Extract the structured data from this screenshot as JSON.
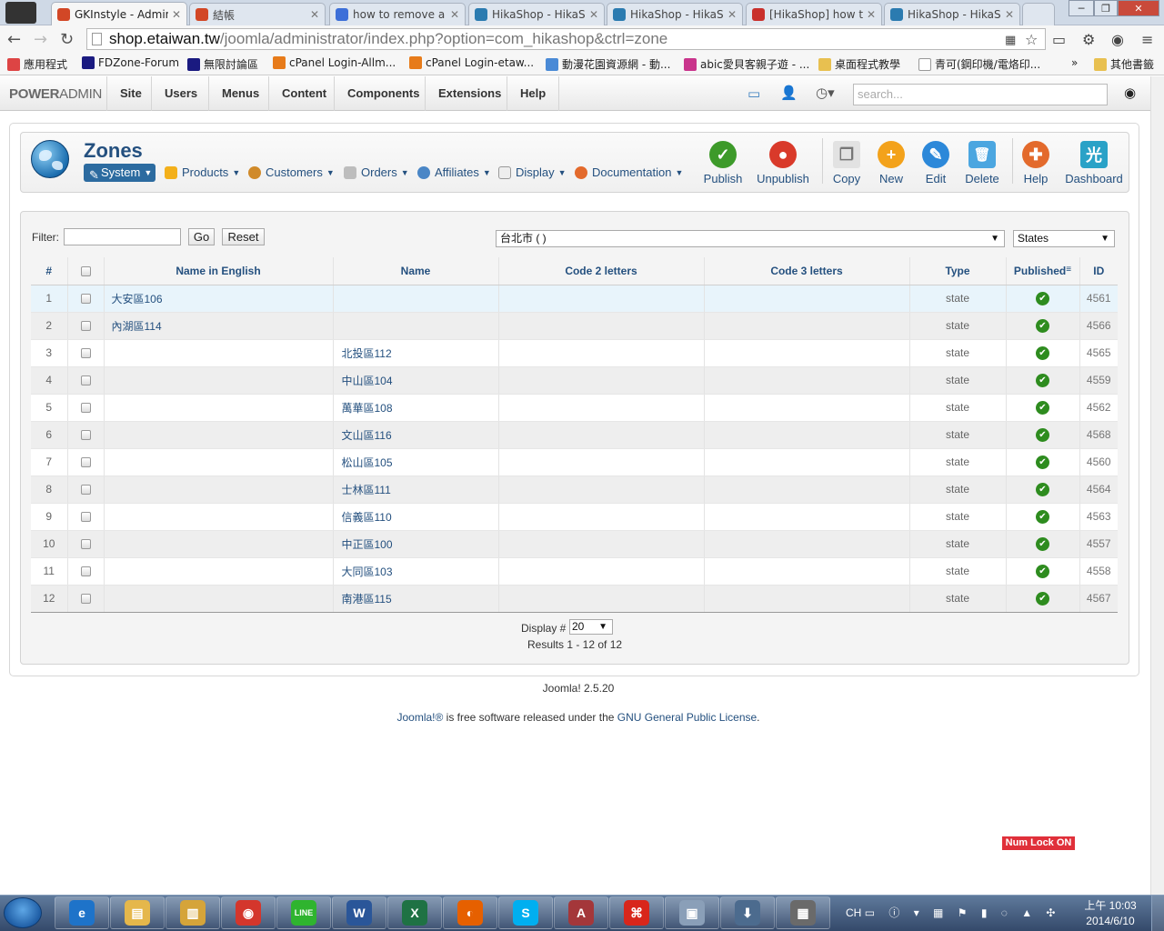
{
  "browser": {
    "tabs": [
      {
        "title": "GKInstyle - Admin",
        "icon_color": "#d24726",
        "active": true
      },
      {
        "title": "結帳",
        "icon_color": "#d24726"
      },
      {
        "title": "how to remove a",
        "icon_color": "#3d6fd8"
      },
      {
        "title": "HikaShop - HikaS",
        "icon_color": "#2b7bb0"
      },
      {
        "title": "HikaShop - HikaS",
        "icon_color": "#2b7bb0"
      },
      {
        "title": "[HikaShop] how t",
        "icon_color": "#c9302c"
      },
      {
        "title": "HikaShop - HikaS",
        "icon_color": "#2b7bb0"
      }
    ],
    "url_host": "shop.etaiwan.tw",
    "url_path": "/joomla/administrator/index.php?option=com_hikashop&ctrl=zone",
    "bookmarks": [
      "應用程式",
      "FDZone-Forum",
      "無限討論區",
      "cPanel Login-Allm...",
      "cPanel Login-etaw...",
      "動漫花園資源網 - 動...",
      "abic愛貝客親子遊 - ...",
      "桌面程式教學",
      "青可(鋼印機/電烙印...",
      "其他書籤"
    ]
  },
  "admin": {
    "logo_bold": "POWER",
    "logo_rest": "ADMIN",
    "menu": [
      "Site",
      "Users",
      "Menus",
      "Content",
      "Components",
      "Extensions",
      "Help"
    ],
    "search_placeholder": "search..."
  },
  "page": {
    "title": "Zones",
    "submenu": [
      "System",
      "Products",
      "Customers",
      "Orders",
      "Affiliates",
      "Display",
      "Documentation"
    ],
    "tools": [
      {
        "label": "Publish",
        "color": "#3d9a2a",
        "glyph": "✓"
      },
      {
        "label": "Unpublish",
        "color": "#d93a2a",
        "glyph": "●"
      },
      {
        "label": "Copy",
        "color": "#c9c9c9",
        "glyph": "❐"
      },
      {
        "label": "New",
        "color": "#f3a21b",
        "glyph": "+"
      },
      {
        "label": "Edit",
        "color": "#2c88d9",
        "glyph": "✎"
      },
      {
        "label": "Delete",
        "color": "#4ba6e0",
        "glyph": "🗑"
      },
      {
        "label": "Help",
        "color": "#e36a2c",
        "glyph": "✚"
      },
      {
        "label": "Dashboard",
        "color": "#2aa2c7",
        "glyph": "光"
      }
    ]
  },
  "filters": {
    "filter_label": "Filter:",
    "filter_value": "",
    "go": "Go",
    "reset": "Reset",
    "zone_select": "台北市 ( )",
    "type_select": "States"
  },
  "table": {
    "headers": [
      "#",
      "Name in English",
      "Name",
      "Code 2 letters",
      "Code 3 letters",
      "Type",
      "Published",
      "ID"
    ],
    "rows": [
      {
        "n": "1",
        "en": "大安區106",
        "name": "",
        "type": "state",
        "id": "4561"
      },
      {
        "n": "2",
        "en": "內湖區114",
        "name": "",
        "type": "state",
        "id": "4566"
      },
      {
        "n": "3",
        "en": "",
        "name": "北投區112",
        "type": "state",
        "id": "4565"
      },
      {
        "n": "4",
        "en": "",
        "name": "中山區104",
        "type": "state",
        "id": "4559"
      },
      {
        "n": "5",
        "en": "",
        "name": "萬華區108",
        "type": "state",
        "id": "4562"
      },
      {
        "n": "6",
        "en": "",
        "name": "文山區116",
        "type": "state",
        "id": "4568"
      },
      {
        "n": "7",
        "en": "",
        "name": "松山區105",
        "type": "state",
        "id": "4560"
      },
      {
        "n": "8",
        "en": "",
        "name": "士林區111",
        "type": "state",
        "id": "4564"
      },
      {
        "n": "9",
        "en": "",
        "name": "信義區110",
        "type": "state",
        "id": "4563"
      },
      {
        "n": "10",
        "en": "",
        "name": "中正區100",
        "type": "state",
        "id": "4557"
      },
      {
        "n": "11",
        "en": "",
        "name": "大同區103",
        "type": "state",
        "id": "4558"
      },
      {
        "n": "12",
        "en": "",
        "name": "南港區115",
        "type": "state",
        "id": "4567"
      }
    ]
  },
  "pagination": {
    "display_label": "Display #",
    "display_value": "20",
    "results": "Results 1 - 12 of 12"
  },
  "footer": {
    "version": "Joomla! 2.5.20",
    "joomla_link": "Joomla!®",
    "middle": " is free software released under the ",
    "license_link": "GNU General Public License",
    "end": "."
  },
  "numlock": "Num Lock ON",
  "taskbar": {
    "apps": [
      {
        "name": "ie",
        "color": "#1e73c9",
        "glyph": "e"
      },
      {
        "name": "explorer",
        "color": "#e5b74b",
        "glyph": "▤"
      },
      {
        "name": "library",
        "color": "#d5a43a",
        "glyph": "▥"
      },
      {
        "name": "chrome",
        "color": "#d4362c",
        "glyph": "◉"
      },
      {
        "name": "line",
        "color": "#2fb42f",
        "glyph": "LINE"
      },
      {
        "name": "word",
        "color": "#2a5699",
        "glyph": "W"
      },
      {
        "name": "excel",
        "color": "#1f7244",
        "glyph": "X"
      },
      {
        "name": "firefox",
        "color": "#e66000",
        "glyph": "◐"
      },
      {
        "name": "skype",
        "color": "#00aff0",
        "glyph": "S"
      },
      {
        "name": "access",
        "color": "#a4373a",
        "glyph": "A"
      },
      {
        "name": "acrobat",
        "color": "#d8261b",
        "glyph": "⌘"
      },
      {
        "name": "remote",
        "color": "#8a9fb8",
        "glyph": "▣"
      },
      {
        "name": "usb",
        "color": "#4c6b8e",
        "glyph": "⬇"
      },
      {
        "name": "filmstrip",
        "color": "#6a6a6a",
        "glyph": "▦"
      }
    ],
    "ime": "CH",
    "time": "上午 10:03",
    "date": "2014/6/10"
  }
}
